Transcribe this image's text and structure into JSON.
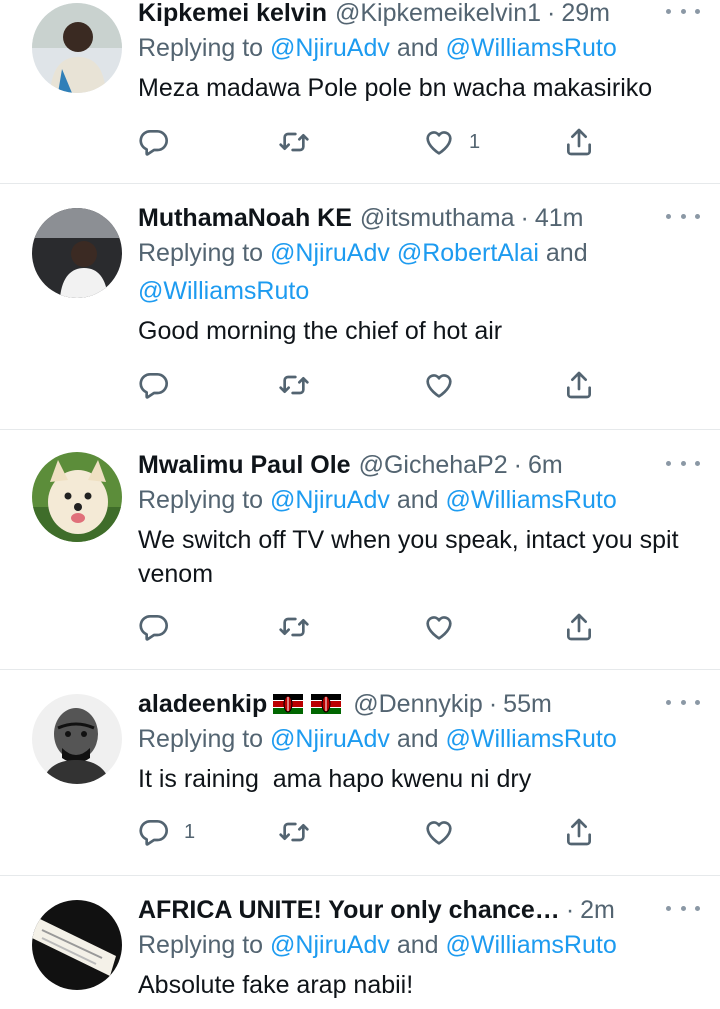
{
  "tweets": [
    {
      "name": "Kipkemei kelvin",
      "handle": "@Kipkemeikelvin1",
      "time": "29m",
      "replying_prefix": "Replying to ",
      "mention1": "@NjiruAdv",
      "joiner": " and ",
      "mention2": "@WilliamsRuto",
      "text": "Meza madawa Pole pole bn wacha makasiriko",
      "reply_count": "",
      "like_count": "1"
    },
    {
      "name": "MuthamaNoah KE",
      "handle": "@itsmuthama",
      "time": "41m",
      "replying_prefix": "Replying to ",
      "mention1": "@NjiruAdv",
      "mention_mid": "@RobertAlai",
      "joiner": " and",
      "mention2": "@WilliamsRuto",
      "text": "Good morning the chief of hot air",
      "reply_count": "",
      "like_count": ""
    },
    {
      "name": "Mwalimu Paul Ole",
      "handle": "@GichehaP2",
      "time": "6m",
      "replying_prefix": "Replying to ",
      "mention1": "@NjiruAdv",
      "joiner": " and ",
      "mention2": "@WilliamsRuto",
      "text": "We switch off TV when you speak, intact you spit venom",
      "reply_count": "",
      "like_count": ""
    },
    {
      "name": "aladeenkip",
      "handle": "@Dennykip",
      "time": "55m",
      "replying_prefix": "Replying to ",
      "mention1": "@NjiruAdv",
      "joiner": " and ",
      "mention2": "@WilliamsRuto",
      "text": "It is raining  ama hapo kwenu ni dry",
      "reply_count": "1",
      "like_count": ""
    },
    {
      "name": "AFRICA UNITE! Your only chance…",
      "handle": "",
      "time": "2m",
      "replying_prefix": "Replying to ",
      "mention1": "@NjiruAdv",
      "joiner": " and ",
      "mention2": "@WilliamsRuto",
      "text": "Absolute fake arap nabii!"
    }
  ],
  "colors": {
    "link": "#1d9bf0",
    "secondary": "#536471",
    "text": "#0f1419",
    "divider": "#e6e9eb"
  },
  "icons": [
    "reply-icon",
    "retweet-icon",
    "like-icon",
    "share-icon",
    "more-icon",
    "kenya-flag-icon"
  ]
}
